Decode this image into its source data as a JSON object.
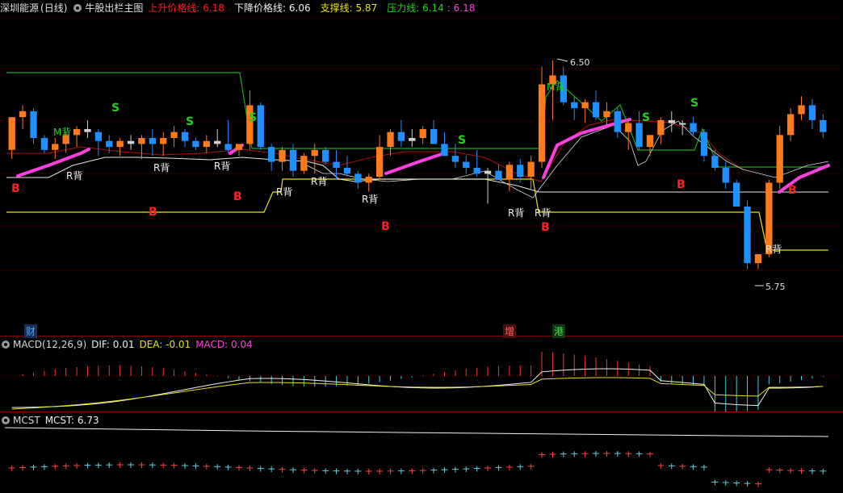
{
  "header": {
    "stock": "深圳能源",
    "period": "(日线)",
    "indicator": "牛股出栏主图",
    "up_label": "上升价格线:",
    "up_value": "6.18",
    "down_label": "下降价格线:",
    "down_value": "6.06",
    "support_label": "支撑线:",
    "support_value": "5.87",
    "pressure_label": "压力线:",
    "pressure_value1": "6.14",
    "pressure_value2": ": 6.18"
  },
  "macd": {
    "name": "MACD(12,26,9)",
    "dif": "DIF: 0.01",
    "dea": "DEA: -0.01",
    "macd": "MACD: 0.04"
  },
  "mcst": {
    "name": "MCST",
    "value": "MCST: 6.73"
  },
  "markers": {
    "cai": "财",
    "zeng": "增",
    "gang": "港"
  },
  "colors": {
    "up": "#ff7a1a",
    "down": "#1e90ff",
    "text_red": "#ff2020",
    "text_green": "#20d020",
    "support": "#e8e020",
    "pressure": "#1fa81f",
    "white_line": "#e8e8e8",
    "magenta": "#ff40e0"
  },
  "chart_data": {
    "type": "candlestick",
    "price_range": [
      5.75,
      6.5
    ],
    "annotations": {
      "high_label": "6.50",
      "low_label": "5.75",
      "S": "S",
      "B": "B",
      "R_bei": "R背",
      "M_bei": "M背"
    },
    "candles": [
      [
        6.2,
        6.31,
        6.17,
        6.31
      ],
      [
        6.31,
        6.35,
        6.27,
        6.33
      ],
      [
        6.33,
        6.34,
        6.22,
        6.24
      ],
      [
        6.24,
        6.25,
        6.19,
        6.2
      ],
      [
        6.2,
        6.24,
        6.17,
        6.22
      ],
      [
        6.22,
        6.26,
        6.19,
        6.25
      ],
      [
        6.25,
        6.28,
        6.21,
        6.27
      ],
      [
        6.27,
        6.3,
        6.24,
        6.26
      ],
      [
        6.26,
        6.27,
        6.18,
        6.23
      ],
      [
        6.23,
        6.25,
        6.19,
        6.21
      ],
      [
        6.21,
        6.24,
        6.18,
        6.23
      ],
      [
        6.23,
        6.25,
        6.2,
        6.22
      ],
      [
        6.22,
        6.25,
        6.17,
        6.24
      ],
      [
        6.24,
        6.27,
        6.18,
        6.22
      ],
      [
        6.22,
        6.26,
        6.18,
        6.24
      ],
      [
        6.24,
        6.28,
        6.21,
        6.26
      ],
      [
        6.26,
        6.27,
        6.21,
        6.23
      ],
      [
        6.23,
        6.24,
        6.2,
        6.21
      ],
      [
        6.21,
        6.25,
        6.19,
        6.23
      ],
      [
        6.23,
        6.27,
        6.21,
        6.22
      ],
      [
        6.22,
        6.3,
        6.19,
        6.2
      ],
      [
        6.2,
        6.22,
        6.18,
        6.22
      ],
      [
        6.22,
        6.4,
        6.2,
        6.35
      ],
      [
        6.35,
        6.36,
        6.2,
        6.21
      ],
      [
        6.21,
        6.22,
        6.13,
        6.16
      ],
      [
        6.16,
        6.21,
        6.13,
        6.2
      ],
      [
        6.2,
        6.22,
        6.11,
        6.13
      ],
      [
        6.13,
        6.19,
        6.12,
        6.18
      ],
      [
        6.18,
        6.22,
        6.12,
        6.2
      ],
      [
        6.2,
        6.21,
        6.15,
        6.16
      ],
      [
        6.16,
        6.2,
        6.1,
        6.14
      ],
      [
        6.14,
        6.18,
        6.11,
        6.12
      ],
      [
        6.12,
        6.13,
        6.07,
        6.09
      ],
      [
        6.09,
        6.12,
        6.06,
        6.11
      ],
      [
        6.11,
        6.25,
        6.1,
        6.21
      ],
      [
        6.21,
        6.27,
        6.18,
        6.26
      ],
      [
        6.26,
        6.3,
        6.21,
        6.23
      ],
      [
        6.23,
        6.27,
        6.21,
        6.24
      ],
      [
        6.24,
        6.28,
        6.22,
        6.27
      ],
      [
        6.27,
        6.3,
        6.22,
        6.22
      ],
      [
        6.22,
        6.26,
        6.18,
        6.18
      ],
      [
        6.18,
        6.22,
        6.14,
        6.16
      ],
      [
        6.16,
        6.18,
        6.12,
        6.14
      ],
      [
        6.14,
        6.2,
        6.11,
        6.12
      ],
      [
        6.12,
        6.14,
        6.02,
        6.13
      ],
      [
        6.13,
        6.15,
        6.1,
        6.1
      ],
      [
        6.1,
        6.16,
        6.06,
        6.15
      ],
      [
        6.15,
        6.17,
        6.09,
        6.11
      ],
      [
        6.11,
        6.18,
        6.07,
        6.16
      ],
      [
        6.16,
        6.48,
        6.14,
        6.42
      ],
      [
        6.42,
        6.5,
        6.3,
        6.45
      ],
      [
        6.45,
        6.48,
        6.35,
        6.36
      ],
      [
        6.36,
        6.38,
        6.3,
        6.34
      ],
      [
        6.34,
        6.37,
        6.29,
        6.36
      ],
      [
        6.36,
        6.4,
        6.3,
        6.31
      ],
      [
        6.31,
        6.36,
        6.28,
        6.33
      ],
      [
        6.33,
        6.34,
        6.24,
        6.26
      ],
      [
        6.26,
        6.3,
        6.2,
        6.29
      ],
      [
        6.29,
        6.33,
        6.2,
        6.21
      ],
      [
        6.21,
        6.25,
        6.18,
        6.25
      ],
      [
        6.25,
        6.31,
        6.22,
        6.3
      ],
      [
        6.3,
        6.33,
        6.26,
        6.29
      ],
      [
        6.29,
        6.3,
        6.25,
        6.29
      ],
      [
        6.29,
        6.31,
        6.25,
        6.26
      ],
      [
        6.26,
        6.27,
        6.16,
        6.18
      ],
      [
        6.18,
        6.2,
        6.13,
        6.14
      ],
      [
        6.14,
        6.16,
        6.07,
        6.09
      ],
      [
        6.09,
        6.1,
        6.01,
        6.01
      ],
      [
        6.01,
        6.03,
        5.8,
        5.82
      ],
      [
        5.82,
        5.85,
        5.8,
        5.85
      ],
      [
        5.85,
        6.1,
        5.84,
        6.09
      ],
      [
        6.09,
        6.28,
        6.07,
        6.25
      ],
      [
        6.25,
        6.34,
        6.23,
        6.32
      ],
      [
        6.32,
        6.38,
        6.3,
        6.35
      ],
      [
        6.35,
        6.37,
        6.27,
        6.3
      ],
      [
        6.3,
        6.32,
        6.24,
        6.26
      ]
    ],
    "lines": [
      {
        "name": "上升价格线",
        "value": 6.18
      },
      {
        "name": "下降价格线",
        "value": 6.06
      },
      {
        "name": "支撑线",
        "value": 5.87
      },
      {
        "name": "压力线",
        "value": 6.14
      }
    ],
    "macd_series": {
      "dif": 0.01,
      "dea": -0.01,
      "macd": 0.04
    },
    "mcst": 6.73
  }
}
